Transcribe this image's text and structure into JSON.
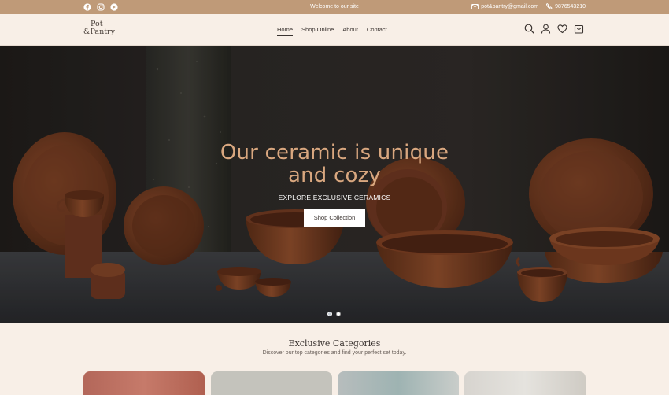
{
  "topbar": {
    "welcome": "Welcome to our site",
    "email": "pot&pantry@gmail.com",
    "phone": "9876543210",
    "socials": [
      "facebook-icon",
      "instagram-icon",
      "youtube-icon"
    ]
  },
  "header": {
    "logo_line1": "Pot",
    "logo_line2": "&Pantry",
    "nav": [
      {
        "label": "Home",
        "active": true
      },
      {
        "label": "Shop Online",
        "active": false
      },
      {
        "label": "About",
        "active": false
      },
      {
        "label": "Contact",
        "active": false
      }
    ],
    "icons": [
      "search-icon",
      "user-icon",
      "heart-icon",
      "cart-icon"
    ]
  },
  "hero": {
    "headline_line1": "Our ceramic is unique",
    "headline_line2": "and cozy",
    "subheading": "EXPLORE EXCLUSIVE CERAMICS",
    "cta_label": "Shop Collection",
    "slide_count": 2,
    "active_slide": 1
  },
  "categories": {
    "title": "Exclusive Categories",
    "description": "Discover our top categories and find your perfect set today."
  },
  "colors": {
    "topbar": "#bf9a78",
    "background": "#f8efe7",
    "headline": "#d9a77f",
    "ceramic": "#7a3e22"
  }
}
